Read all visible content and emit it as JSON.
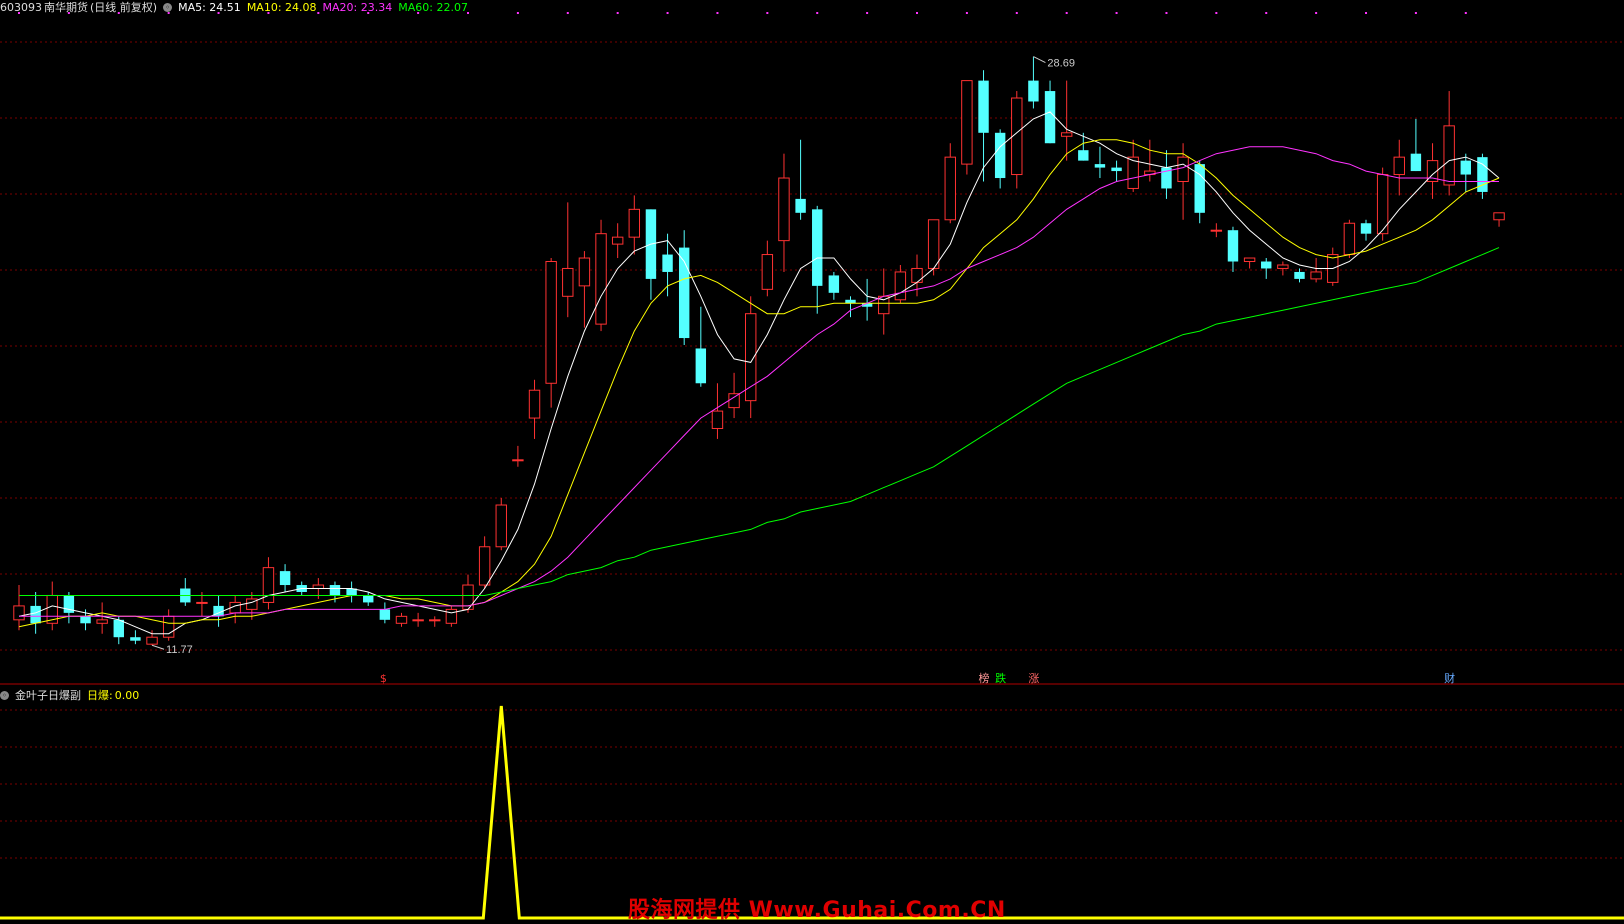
{
  "main": {
    "code": "603093",
    "name": "南华期货",
    "mode": "(日线 前复权)",
    "ma": [
      {
        "label": "MA5:",
        "value": "24.51",
        "color": "#ffffff"
      },
      {
        "label": "MA10:",
        "value": "24.08",
        "color": "#ffff00"
      },
      {
        "label": "MA20:",
        "value": "23.34",
        "color": "#ff33ff"
      },
      {
        "label": "MA60:",
        "value": "22.07",
        "color": "#00ff00"
      }
    ],
    "high_label": "28.69",
    "low_label": "11.77",
    "markers": [
      {
        "text": "$",
        "color": "#ff3333",
        "idx": 22
      },
      {
        "text": "榜",
        "color": "#ff9999",
        "idx": 58
      },
      {
        "text": "跌",
        "color": "#00ff00",
        "idx": 59
      },
      {
        "text": "涨",
        "color": "#ff6666",
        "idx": 61
      },
      {
        "text": "财",
        "color": "#66aaff",
        "idx": 86
      }
    ]
  },
  "sub": {
    "title": "金叶子日爆副",
    "label": "日爆:",
    "value": "0.00"
  },
  "watermark": "股海网提供 Www.Guhai.Com.CN",
  "colors": {
    "up": "#ff3232",
    "down": "#54ffff",
    "grid": "#7a0000",
    "divider": "#b00000",
    "signal": "#ffff00"
  },
  "chart_data": {
    "type": "candlestick",
    "ylim": [
      11.0,
      29.8
    ],
    "ohlc": [
      [
        12.5,
        13.5,
        12.2,
        12.9
      ],
      [
        12.9,
        13.3,
        12.1,
        12.4
      ],
      [
        12.4,
        13.6,
        12.2,
        13.2
      ],
      [
        13.2,
        13.3,
        12.4,
        12.7
      ],
      [
        12.6,
        12.8,
        12.2,
        12.4
      ],
      [
        12.4,
        13.0,
        12.1,
        12.5
      ],
      [
        12.5,
        12.6,
        11.8,
        12.0
      ],
      [
        12.0,
        12.2,
        11.8,
        11.9
      ],
      [
        11.8,
        12.2,
        11.77,
        12.0
      ],
      [
        12.0,
        12.8,
        11.9,
        12.6
      ],
      [
        13.4,
        13.7,
        12.9,
        13.0
      ],
      [
        13.0,
        13.3,
        12.6,
        13.0
      ],
      [
        12.9,
        13.2,
        12.3,
        12.6
      ],
      [
        12.7,
        13.2,
        12.4,
        13.0
      ],
      [
        12.8,
        13.3,
        12.5,
        13.1
      ],
      [
        13.0,
        14.3,
        12.8,
        14.0
      ],
      [
        13.9,
        14.1,
        13.3,
        13.5
      ],
      [
        13.5,
        13.6,
        13.2,
        13.3
      ],
      [
        13.4,
        13.7,
        13.1,
        13.5
      ],
      [
        13.5,
        13.6,
        13.0,
        13.2
      ],
      [
        13.4,
        13.6,
        13.0,
        13.2
      ],
      [
        13.2,
        13.3,
        12.9,
        13.0
      ],
      [
        12.8,
        13.0,
        12.4,
        12.5
      ],
      [
        12.4,
        12.7,
        12.3,
        12.6
      ],
      [
        12.5,
        12.7,
        12.3,
        12.5
      ],
      [
        12.5,
        12.6,
        12.3,
        12.5
      ],
      [
        12.4,
        12.9,
        12.3,
        12.8
      ],
      [
        12.8,
        13.8,
        12.7,
        13.5
      ],
      [
        13.5,
        14.9,
        13.4,
        14.6
      ],
      [
        14.6,
        16.0,
        14.5,
        15.8
      ],
      [
        17.1,
        17.5,
        16.9,
        17.1
      ],
      [
        18.3,
        19.4,
        17.7,
        19.1
      ],
      [
        19.3,
        22.9,
        18.6,
        22.8
      ],
      [
        21.8,
        24.5,
        21.2,
        22.6
      ],
      [
        22.1,
        23.1,
        20.9,
        22.9
      ],
      [
        21.0,
        24.0,
        20.8,
        23.6
      ],
      [
        23.3,
        23.9,
        22.9,
        23.5
      ],
      [
        23.5,
        24.7,
        23.0,
        24.3
      ],
      [
        24.3,
        24.3,
        21.7,
        22.3
      ],
      [
        23.0,
        23.6,
        21.8,
        22.5
      ],
      [
        23.2,
        23.7,
        20.4,
        20.6
      ],
      [
        20.3,
        21.5,
        19.2,
        19.3
      ],
      [
        18.0,
        19.3,
        17.7,
        18.5
      ],
      [
        18.6,
        19.6,
        18.3,
        19.0
      ],
      [
        18.8,
        21.8,
        18.3,
        21.3
      ],
      [
        22.0,
        23.4,
        21.8,
        23.0
      ],
      [
        23.4,
        25.9,
        22.5,
        25.2
      ],
      [
        24.6,
        26.3,
        24.0,
        24.2
      ],
      [
        24.3,
        24.4,
        21.3,
        22.1
      ],
      [
        22.4,
        22.5,
        21.7,
        21.9
      ],
      [
        21.7,
        21.8,
        21.2,
        21.6
      ],
      [
        21.6,
        22.3,
        21.1,
        21.5
      ],
      [
        21.3,
        22.6,
        20.7,
        21.8
      ],
      [
        21.7,
        22.7,
        21.6,
        22.5
      ],
      [
        22.2,
        23.0,
        21.8,
        22.6
      ],
      [
        22.6,
        24.0,
        22.4,
        24.0
      ],
      [
        24.0,
        26.2,
        23.9,
        25.8
      ],
      [
        25.6,
        28.0,
        25.3,
        28.0
      ],
      [
        28.0,
        28.3,
        25.1,
        26.5
      ],
      [
        26.5,
        26.6,
        24.9,
        25.2
      ],
      [
        25.3,
        27.7,
        24.9,
        27.5
      ],
      [
        28.0,
        28.69,
        27.2,
        27.4
      ],
      [
        27.7,
        28.0,
        26.2,
        26.2
      ],
      [
        26.4,
        28.0,
        25.7,
        26.5
      ],
      [
        26.0,
        26.5,
        25.7,
        25.7
      ],
      [
        25.6,
        26.1,
        25.2,
        25.5
      ],
      [
        25.5,
        25.7,
        25.1,
        25.4
      ],
      [
        24.9,
        26.3,
        24.8,
        25.8
      ],
      [
        25.3,
        26.3,
        25.1,
        25.4
      ],
      [
        25.5,
        26.0,
        24.6,
        24.9
      ],
      [
        25.1,
        26.2,
        24.0,
        25.8
      ],
      [
        25.6,
        25.7,
        23.9,
        24.2
      ],
      [
        23.7,
        23.9,
        23.5,
        23.7
      ],
      [
        23.7,
        23.8,
        22.5,
        22.8
      ],
      [
        22.8,
        22.9,
        22.6,
        22.9
      ],
      [
        22.8,
        22.9,
        22.3,
        22.6
      ],
      [
        22.6,
        22.8,
        22.4,
        22.7
      ],
      [
        22.5,
        22.6,
        22.2,
        22.3
      ],
      [
        22.3,
        22.9,
        22.2,
        22.5
      ],
      [
        22.2,
        23.2,
        22.1,
        23.0
      ],
      [
        23.0,
        24.0,
        22.9,
        23.9
      ],
      [
        23.9,
        24.0,
        23.4,
        23.6
      ],
      [
        23.6,
        25.5,
        23.4,
        25.3
      ],
      [
        25.3,
        26.3,
        24.7,
        25.8
      ],
      [
        25.9,
        26.9,
        25.4,
        25.4
      ],
      [
        25.1,
        26.2,
        24.6,
        25.7
      ],
      [
        25.0,
        27.7,
        24.7,
        26.7
      ],
      [
        25.7,
        25.9,
        24.8,
        25.3
      ],
      [
        25.8,
        25.9,
        24.6,
        24.8
      ],
      [
        24.0,
        24.2,
        23.8,
        24.2
      ]
    ],
    "ma5": [
      12.6,
      12.7,
      12.9,
      12.8,
      12.7,
      12.6,
      12.5,
      12.3,
      12.1,
      12.1,
      12.4,
      12.5,
      12.7,
      12.9,
      13.0,
      13.2,
      13.3,
      13.4,
      13.4,
      13.4,
      13.4,
      13.3,
      13.1,
      13.0,
      12.9,
      12.8,
      12.7,
      12.8,
      13.4,
      14.2,
      15.1,
      16.4,
      18.0,
      19.5,
      20.8,
      21.8,
      22.6,
      23.1,
      23.3,
      23.4,
      22.8,
      21.8,
      20.7,
      20.0,
      19.9,
      20.7,
      21.7,
      22.6,
      22.9,
      22.9,
      22.3,
      21.8,
      21.7,
      21.9,
      22.2,
      22.6,
      23.3,
      24.5,
      25.5,
      26.1,
      26.5,
      26.9,
      27.1,
      26.6,
      26.4,
      26.2,
      25.9,
      25.7,
      25.6,
      25.5,
      25.6,
      25.3,
      24.8,
      24.2,
      23.7,
      23.3,
      22.9,
      22.7,
      22.6,
      22.6,
      22.8,
      23.2,
      23.7,
      24.3,
      24.8,
      25.3,
      25.7,
      25.8,
      25.6,
      25.2
    ],
    "ma10": [
      12.3,
      12.4,
      12.5,
      12.6,
      12.6,
      12.7,
      12.6,
      12.6,
      12.5,
      12.4,
      12.4,
      12.5,
      12.5,
      12.6,
      12.6,
      12.7,
      12.8,
      12.9,
      13.0,
      13.1,
      13.2,
      13.2,
      13.2,
      13.1,
      13.1,
      13.0,
      12.9,
      12.9,
      13.0,
      13.3,
      13.6,
      14.1,
      14.9,
      16.1,
      17.3,
      18.5,
      19.7,
      20.8,
      21.6,
      22.1,
      22.3,
      22.4,
      22.2,
      21.9,
      21.6,
      21.3,
      21.3,
      21.5,
      21.5,
      21.6,
      21.6,
      21.6,
      21.6,
      21.6,
      21.6,
      21.7,
      22.0,
      22.6,
      23.2,
      23.6,
      24.0,
      24.6,
      25.3,
      25.9,
      26.2,
      26.3,
      26.3,
      26.2,
      26.0,
      25.9,
      25.9,
      25.6,
      25.2,
      24.7,
      24.3,
      23.9,
      23.5,
      23.2,
      23.0,
      22.9,
      23.0,
      23.1,
      23.3,
      23.5,
      23.7,
      24.0,
      24.4,
      24.8,
      25.0,
      25.2
    ],
    "ma20": [
      12.6,
      12.6,
      12.6,
      12.6,
      12.6,
      12.6,
      12.6,
      12.6,
      12.6,
      12.6,
      12.6,
      12.6,
      12.6,
      12.7,
      12.7,
      12.7,
      12.8,
      12.8,
      12.8,
      12.8,
      12.8,
      12.8,
      12.8,
      12.9,
      12.9,
      12.9,
      12.9,
      12.9,
      13.0,
      13.2,
      13.4,
      13.6,
      13.9,
      14.3,
      14.8,
      15.3,
      15.8,
      16.3,
      16.8,
      17.3,
      17.8,
      18.3,
      18.6,
      18.9,
      19.2,
      19.5,
      19.9,
      20.3,
      20.7,
      21.0,
      21.4,
      21.6,
      21.8,
      21.9,
      22.0,
      22.1,
      22.3,
      22.6,
      22.8,
      23.0,
      23.2,
      23.5,
      23.9,
      24.3,
      24.6,
      24.9,
      25.1,
      25.2,
      25.3,
      25.4,
      25.5,
      25.7,
      25.9,
      26.0,
      26.1,
      26.1,
      26.1,
      26.0,
      25.9,
      25.7,
      25.6,
      25.4,
      25.3,
      25.2,
      25.2,
      25.2,
      25.1,
      25.1,
      25.1,
      25.1
    ],
    "ma60": [
      13.2,
      13.2,
      13.2,
      13.2,
      13.2,
      13.2,
      13.2,
      13.2,
      13.2,
      13.2,
      13.2,
      13.2,
      13.2,
      13.2,
      13.2,
      13.2,
      13.2,
      13.2,
      13.2,
      13.2,
      13.2,
      13.2,
      13.2,
      13.2,
      13.2,
      13.2,
      13.2,
      13.2,
      13.2,
      13.3,
      13.4,
      13.5,
      13.6,
      13.8,
      13.9,
      14.0,
      14.2,
      14.3,
      14.5,
      14.6,
      14.7,
      14.8,
      14.9,
      15.0,
      15.1,
      15.3,
      15.4,
      15.6,
      15.7,
      15.8,
      15.9,
      16.1,
      16.3,
      16.5,
      16.7,
      16.9,
      17.2,
      17.5,
      17.8,
      18.1,
      18.4,
      18.7,
      19.0,
      19.3,
      19.5,
      19.7,
      19.9,
      20.1,
      20.3,
      20.5,
      20.7,
      20.8,
      21.0,
      21.1,
      21.2,
      21.3,
      21.4,
      21.5,
      21.6,
      21.7,
      21.8,
      21.9,
      22.0,
      22.1,
      22.2,
      22.4,
      22.6,
      22.8,
      23.0,
      23.2
    ],
    "sub_signal": {
      "ylim": [
        0,
        1
      ],
      "values_nonzero_index": 29,
      "peak_value": 1.0,
      "current": 0.0
    }
  }
}
